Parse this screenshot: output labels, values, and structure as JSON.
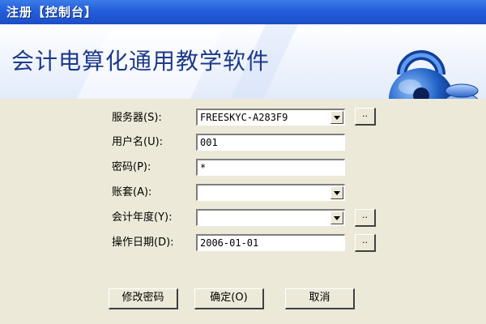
{
  "window": {
    "title": "注册【控制台】"
  },
  "banner": {
    "title": "会计电算化通用教学软件"
  },
  "form": {
    "server": {
      "label": "服务器(S):",
      "value": "FREESKYC-A283F9",
      "browse": ".."
    },
    "username": {
      "label": "用户名(U):",
      "value": "001"
    },
    "password": {
      "label": "密码(P):",
      "value": "*"
    },
    "account": {
      "label": "账套(A):",
      "value": ""
    },
    "year": {
      "label": "会计年度(Y):",
      "value": "",
      "browse": ".."
    },
    "date": {
      "label": "操作日期(D):",
      "value": "2006-01-01",
      "browse": ".."
    }
  },
  "buttons": {
    "change_password": "修改密码",
    "ok": "确定(O)",
    "cancel": "取消"
  },
  "colors": {
    "titlebar": "#245edb",
    "face": "#ece9d8",
    "banner_text": "#1e3a8a",
    "lock": "#1e5fc4"
  },
  "icons": {
    "logo": "padlock-coins-icon",
    "dropdown": "chevron-down-icon"
  }
}
